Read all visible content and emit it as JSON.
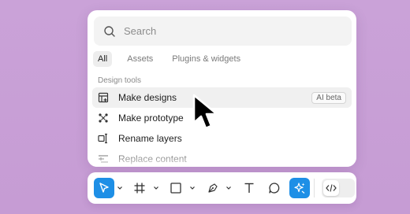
{
  "search": {
    "placeholder": "Search"
  },
  "tabs": [
    {
      "label": "All",
      "active": true
    },
    {
      "label": "Assets",
      "active": false
    },
    {
      "label": "Plugins & widgets",
      "active": false
    }
  ],
  "section": {
    "label": "Design tools"
  },
  "menu": [
    {
      "label": "Make designs",
      "icon": "make-designs-icon",
      "badge": "AI beta",
      "highlighted": true
    },
    {
      "label": "Make prototype",
      "icon": "prototype-icon"
    },
    {
      "label": "Rename layers",
      "icon": "rename-layers-icon"
    },
    {
      "label": "Replace content",
      "icon": "replace-content-icon"
    }
  ],
  "toolbar": {
    "tools": [
      {
        "name": "move",
        "icon": "cursor-arrow-icon",
        "active": true
      },
      {
        "name": "frame",
        "icon": "frame-hash-icon"
      },
      {
        "name": "shape",
        "icon": "rectangle-icon"
      },
      {
        "name": "pen",
        "icon": "pen-nib-icon"
      },
      {
        "name": "text",
        "icon": "text-t-icon"
      },
      {
        "name": "comment",
        "icon": "comment-bubble-icon"
      },
      {
        "name": "actions",
        "icon": "sparkle-icon",
        "active": true
      }
    ],
    "dev_mode_icon": "code-brackets-icon"
  },
  "colors": {
    "background": "#c9a0d6",
    "accent": "#1e8fe6",
    "panel": "#ffffff"
  }
}
